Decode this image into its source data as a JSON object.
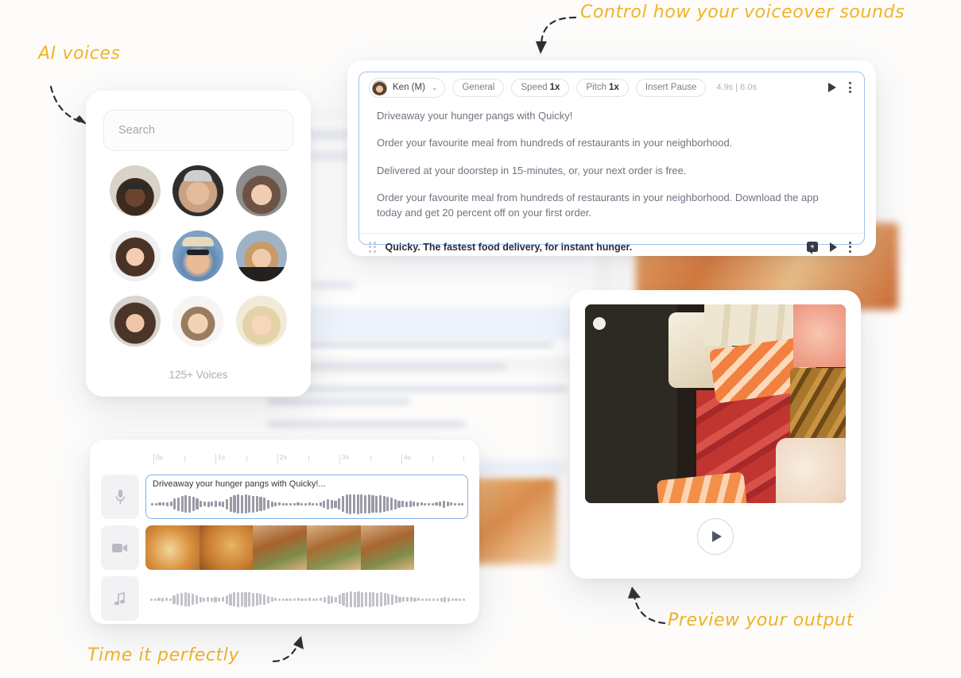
{
  "background_app": {
    "present": true
  },
  "annotations": [
    {
      "id": "ai-voices",
      "text": "AI voices"
    },
    {
      "id": "control-voiceover",
      "text": "Control how your voiceover sounds"
    },
    {
      "id": "time-it",
      "text": "Time it perfectly"
    },
    {
      "id": "preview-output",
      "text": "Preview your output"
    }
  ],
  "voices_panel": {
    "search": {
      "placeholder": "Search",
      "value": ""
    },
    "voices_count": "125+ Voices",
    "avatars": [
      {
        "name": "voice-avatar-1"
      },
      {
        "name": "voice-avatar-2"
      },
      {
        "name": "voice-avatar-3"
      },
      {
        "name": "voice-avatar-4"
      },
      {
        "name": "voice-avatar-5"
      },
      {
        "name": "voice-avatar-6"
      },
      {
        "name": "voice-avatar-7"
      },
      {
        "name": "voice-avatar-8"
      },
      {
        "name": "voice-avatar-9"
      }
    ]
  },
  "script_card": {
    "toolbar": {
      "voice_name": "Ken (M)",
      "chevron": "⌄",
      "chips": [
        {
          "label": "General",
          "value": ""
        },
        {
          "label": "Speed",
          "value": "1x"
        },
        {
          "label": "Pitch",
          "value": "1x"
        },
        {
          "label": "Insert Pause",
          "value": ""
        }
      ],
      "durations": "4.9s | 6.0s"
    },
    "paragraphs": [
      "Driveaway your hunger pangs with Quicky!",
      "Order your favourite meal from hundreds of restaurants in your neighborhood.",
      "Delivered at your doorstep in 15-minutes, or, your next order is free.",
      "Order your favourite meal from hundreds of restaurants in your neighborhood. Download the app today and get 20 percent off on your first order."
    ],
    "footer": {
      "text": "Quicky. The fastest food delivery, for instant hunger.",
      "comment_badge": "+"
    }
  },
  "timeline_card": {
    "ruler_labels": [
      "0s",
      "1s",
      "2s",
      "3s",
      "4s"
    ],
    "tracks": [
      {
        "type": "audio",
        "icon": "microphone-icon",
        "clip_label": "Driveaway your hunger pangs with Quicky!...",
        "selected": true
      },
      {
        "type": "video",
        "icon": "video-camera-icon",
        "clip_label": "",
        "selected": false
      },
      {
        "type": "music",
        "icon": "music-note-icon",
        "clip_label": "",
        "selected": false
      }
    ]
  },
  "preview_card": {
    "image_alt": "sushi-platter",
    "play_button": "play-icon"
  },
  "colors": {
    "page_background": "#fdfcfb",
    "annotation": "#f0b323",
    "accent_border": "#9ec2ee",
    "text_primary": "#2d2d38",
    "text_muted": "#7d7d87"
  }
}
